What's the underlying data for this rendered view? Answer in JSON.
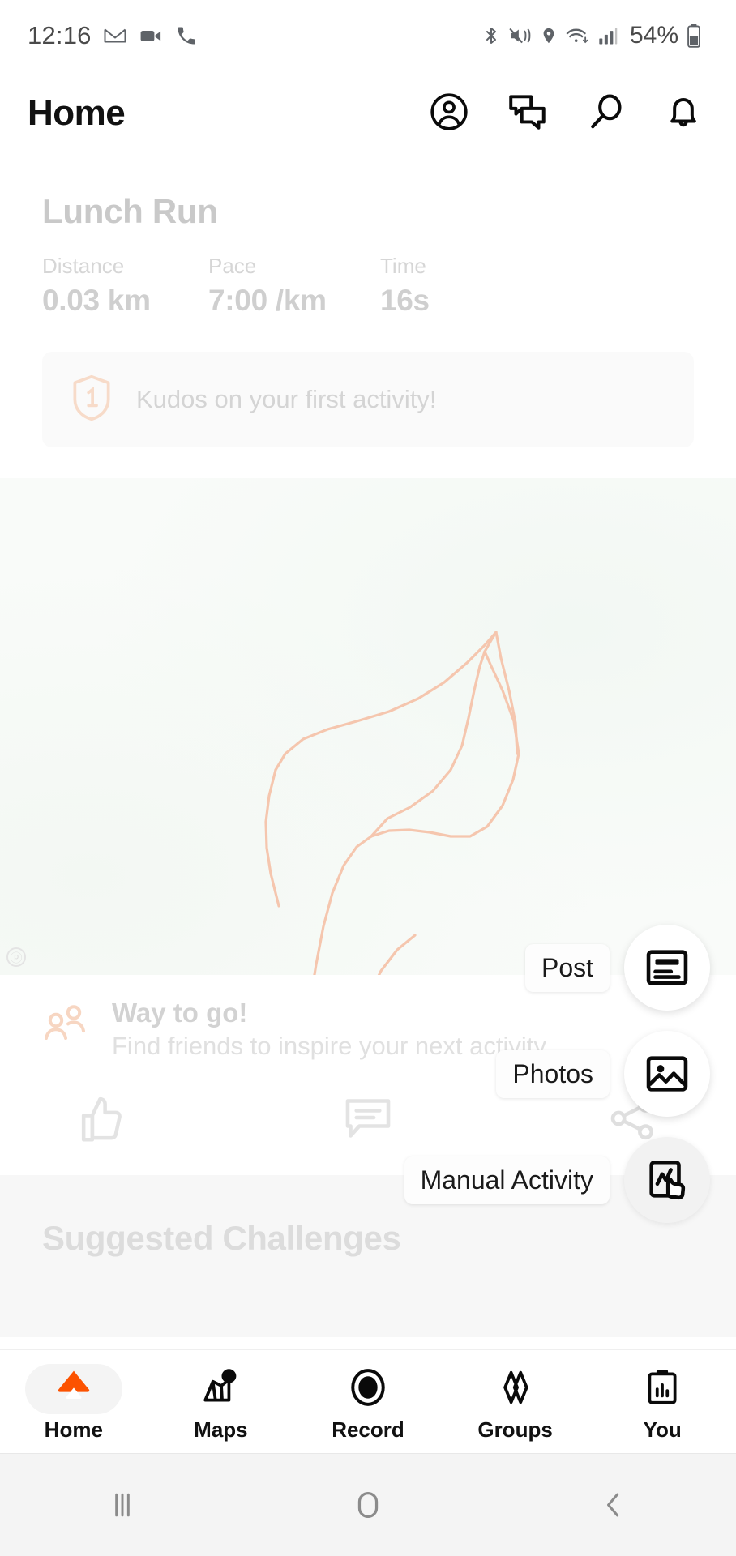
{
  "status_bar": {
    "time": "12:16",
    "battery_percent": "54%",
    "left_icons": [
      "gmail-icon",
      "video-camera-icon",
      "phone-icon"
    ],
    "right_icons": [
      "bluetooth-icon",
      "vibrate-mute-icon",
      "location-pin-icon",
      "wifi-icon",
      "cellular-signal-icon",
      "battery-icon"
    ]
  },
  "header": {
    "title": "Home",
    "actions": [
      {
        "name": "profile-icon"
      },
      {
        "name": "chat-icon"
      },
      {
        "name": "search-icon"
      },
      {
        "name": "notifications-bell-icon"
      }
    ]
  },
  "feed": {
    "activity": {
      "title": "Lunch Run",
      "stats": [
        {
          "label": "Distance",
          "value": "0.03 km"
        },
        {
          "label": "Pace",
          "value": "7:00 /km"
        },
        {
          "label": "Time",
          "value": "16s"
        }
      ],
      "kudos_banner": {
        "icon": "badge-one-icon",
        "text": "Kudos on your first activity!"
      },
      "map": {
        "route_color": "#f5c6ae",
        "attribution": "map-attribution-icon"
      },
      "social_actions": [
        "thumbs-up-icon",
        "comment-icon",
        "share-icon"
      ]
    },
    "find_friends": {
      "icon": "people-icon",
      "title": "Way to go!",
      "subtitle": "Find friends to inspire your next activity"
    },
    "challenges": {
      "title": "Suggested Challenges"
    }
  },
  "speed_dial": {
    "items": [
      {
        "label": "Post",
        "icon": "article-post-icon"
      },
      {
        "label": "Photos",
        "icon": "image-photo-icon"
      },
      {
        "label": "Manual Activity",
        "icon": "manual-activity-icon"
      }
    ]
  },
  "bottom_nav": {
    "active": "Home",
    "items": [
      {
        "label": "Home",
        "icon": "home-icon"
      },
      {
        "label": "Maps",
        "icon": "maps-icon"
      },
      {
        "label": "Record",
        "icon": "record-icon"
      },
      {
        "label": "Groups",
        "icon": "groups-icon"
      },
      {
        "label": "You",
        "icon": "you-clipboard-icon"
      }
    ]
  },
  "android_nav": {
    "items": [
      {
        "name": "recents-icon"
      },
      {
        "name": "home-circle-icon"
      },
      {
        "name": "back-icon"
      }
    ]
  },
  "colors": {
    "accent": "#fc5200",
    "route": "#f5c6ae",
    "dimmed_text": "#d2d2d2"
  }
}
